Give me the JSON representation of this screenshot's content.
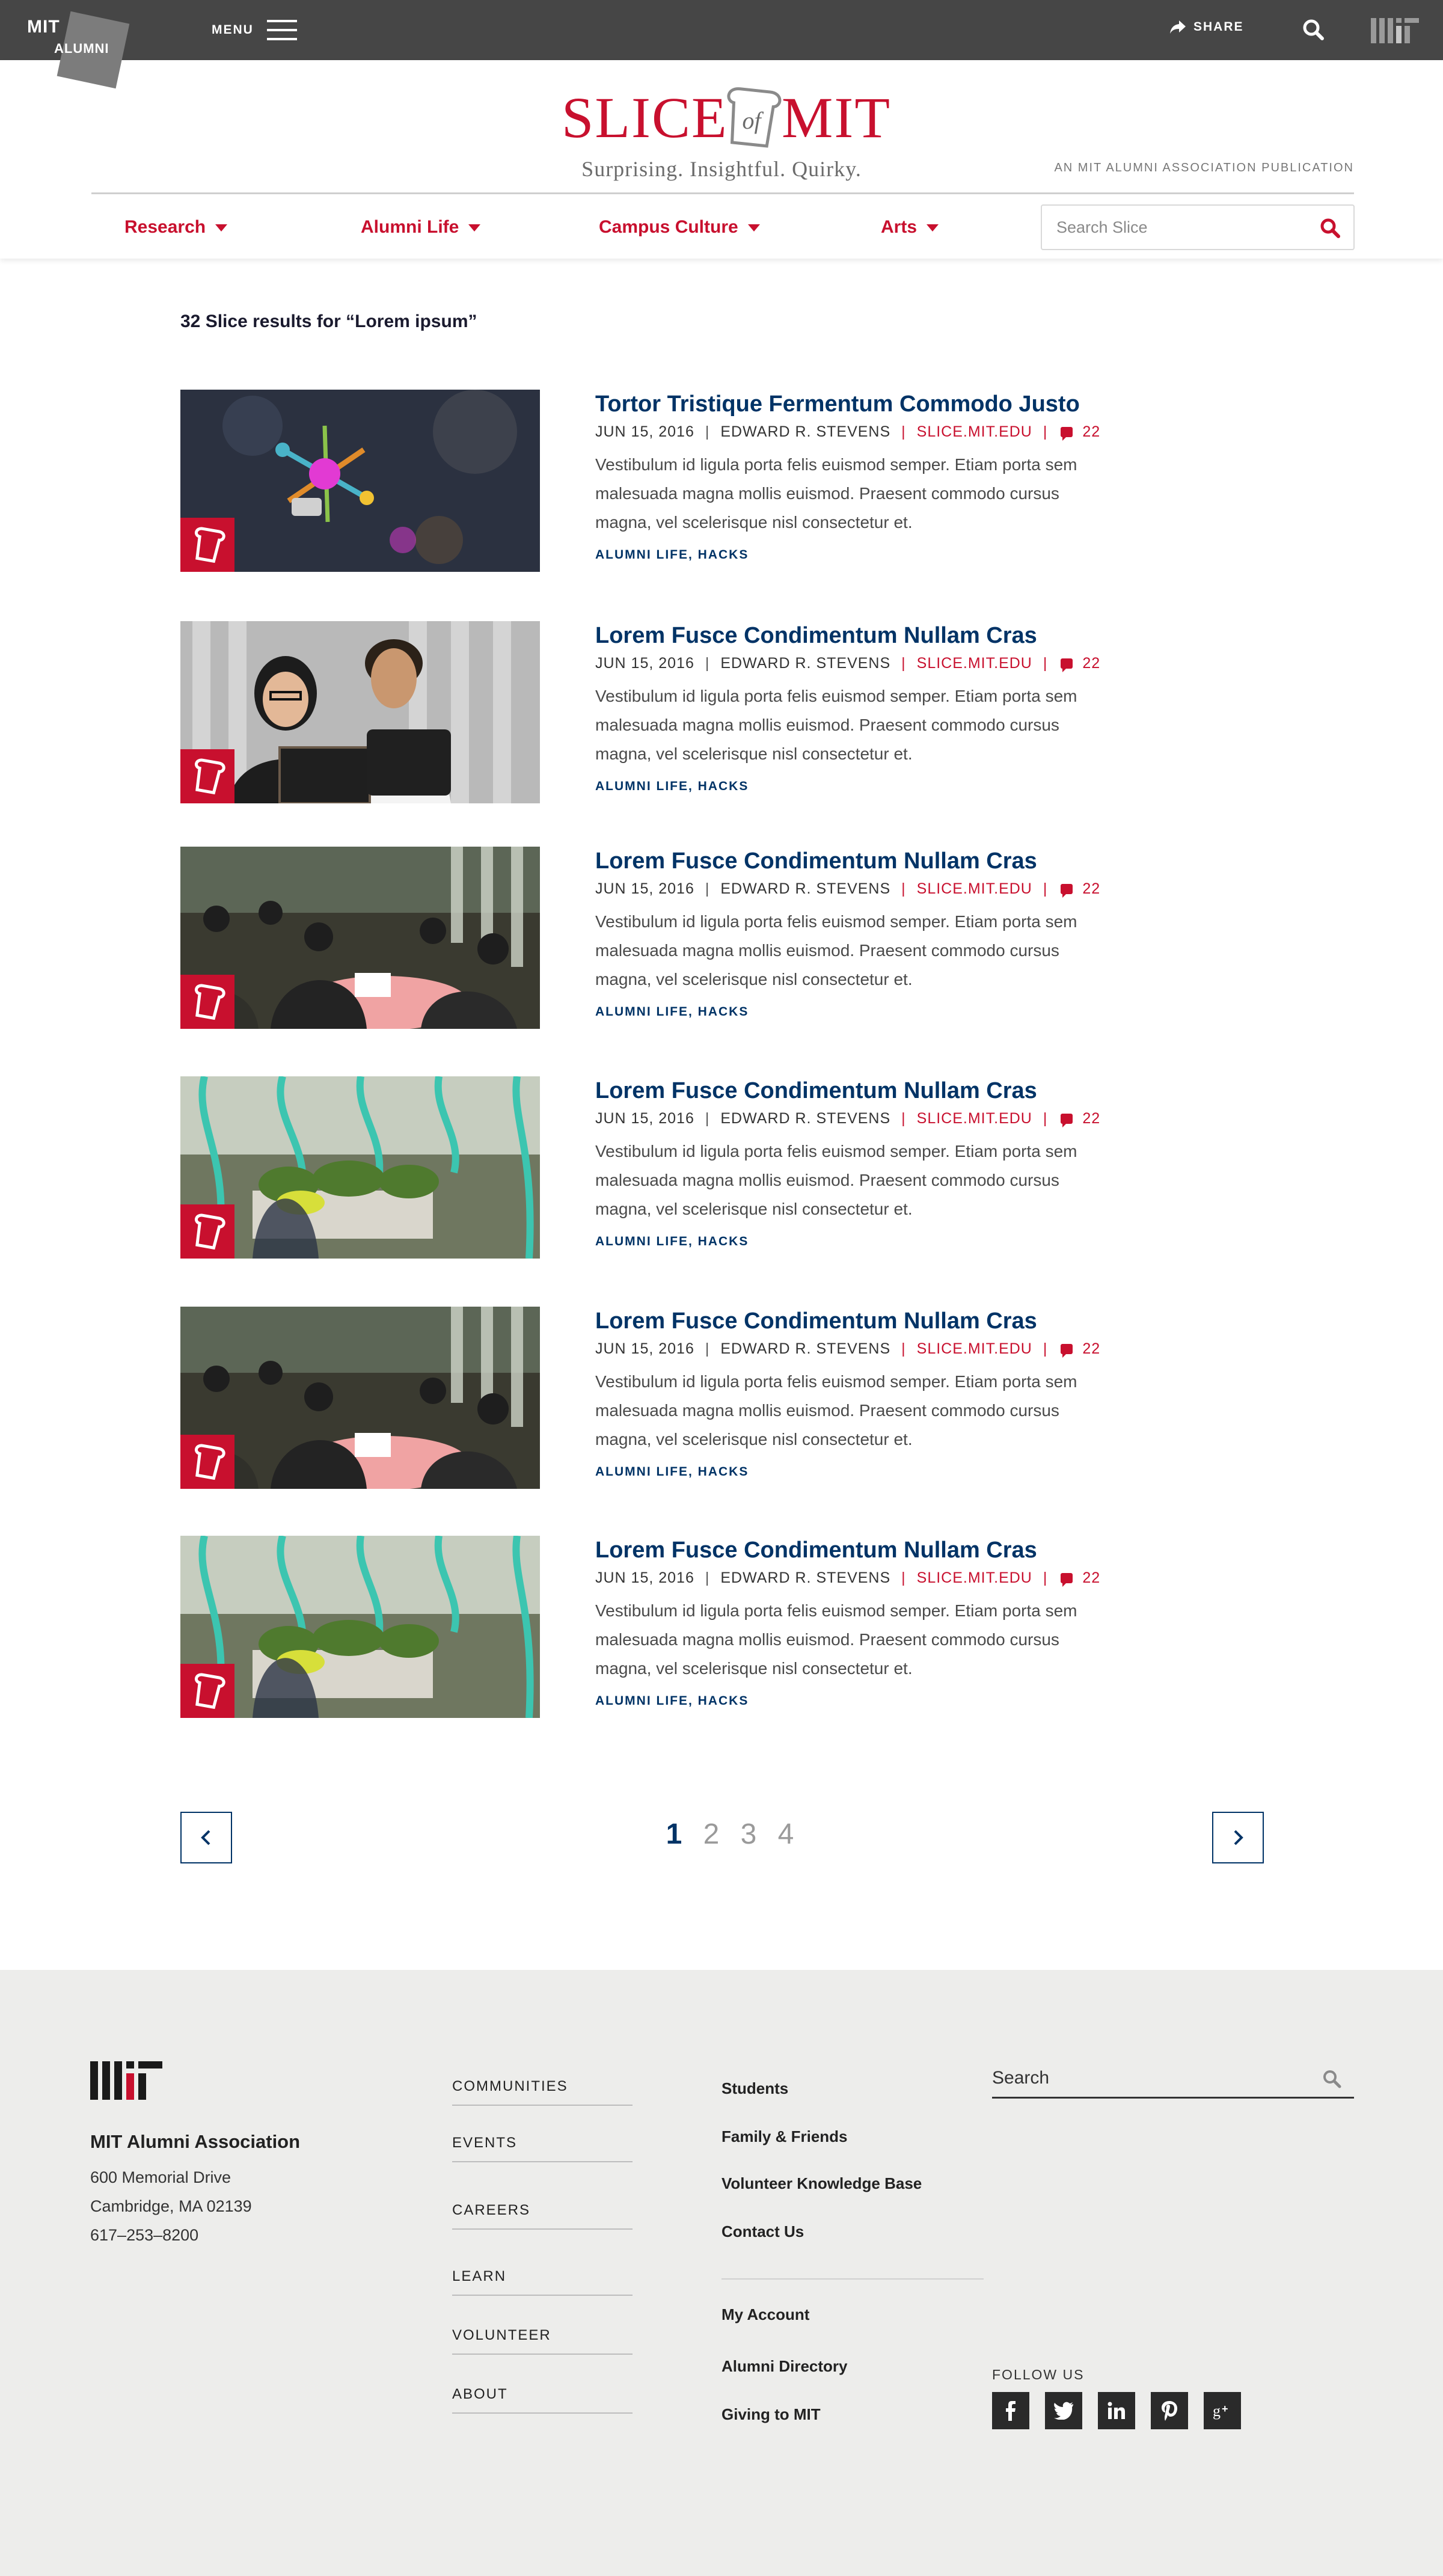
{
  "topbar": {
    "logo_mit": "MIT",
    "logo_alumni": "ALUMNI",
    "menu_label": "MENU",
    "share_label": "SHARE"
  },
  "masthead": {
    "slice_left": "SLICE",
    "slice_of": "of",
    "slice_right": "MIT",
    "tagline": "Surprising. Insightful. Quirky.",
    "publication": "AN MIT ALUMNI ASSOCIATION PUBLICATION"
  },
  "nav": {
    "items": [
      {
        "label": "Research"
      },
      {
        "label": "Alumni Life"
      },
      {
        "label": "Campus Culture"
      },
      {
        "label": "Arts"
      }
    ],
    "search_placeholder": "Search Slice"
  },
  "results": {
    "count_text": "32 Slice results for “Lorem ipsum”",
    "items": [
      {
        "title": "Tortor Tristique Fermentum Commodo Justo",
        "date": "JUN 15, 2016",
        "author": "EDWARD R. STEVENS",
        "site": "SLICE.MIT.EDU",
        "comments": "22",
        "excerpt": "Vestibulum id ligula porta felis euismod semper. Etiam porta sem malesuada magna mollis euismod. Praesent commodo cursus magna, vel scelerisque nisl consectetur et.",
        "cat1": "ALUMNI LIFE",
        "cat2": "HACKS"
      },
      {
        "title": "Lorem Fusce Condimentum Nullam Cras",
        "date": "JUN 15, 2016",
        "author": "EDWARD R. STEVENS",
        "site": "SLICE.MIT.EDU",
        "comments": "22",
        "excerpt": "Vestibulum id ligula porta felis euismod semper. Etiam porta sem malesuada magna mollis euismod. Praesent commodo cursus magna, vel scelerisque nisl consectetur et.",
        "cat1": "ALUMNI LIFE",
        "cat2": "HACKS"
      },
      {
        "title": "Lorem Fusce Condimentum Nullam Cras",
        "date": "JUN 15, 2016",
        "author": "EDWARD R. STEVENS",
        "site": "SLICE.MIT.EDU",
        "comments": "22",
        "excerpt": "Vestibulum id ligula porta felis euismod semper. Etiam porta sem malesuada magna mollis euismod. Praesent commodo cursus magna, vel scelerisque nisl consectetur et.",
        "cat1": "ALUMNI LIFE",
        "cat2": "HACKS"
      },
      {
        "title": "Lorem Fusce Condimentum Nullam Cras",
        "date": "JUN 15, 2016",
        "author": "EDWARD R. STEVENS",
        "site": "SLICE.MIT.EDU",
        "comments": "22",
        "excerpt": "Vestibulum id ligula porta felis euismod semper. Etiam porta sem malesuada magna mollis euismod. Praesent commodo cursus magna, vel scelerisque nisl consectetur et.",
        "cat1": "ALUMNI LIFE",
        "cat2": "HACKS"
      },
      {
        "title": "Lorem Fusce Condimentum Nullam Cras",
        "date": "JUN 15, 2016",
        "author": "EDWARD R. STEVENS",
        "site": "SLICE.MIT.EDU",
        "comments": "22",
        "excerpt": "Vestibulum id ligula porta felis euismod semper. Etiam porta sem malesuada magna mollis euismod. Praesent commodo cursus magna, vel scelerisque nisl consectetur et.",
        "cat1": "ALUMNI LIFE",
        "cat2": "HACKS"
      },
      {
        "title": "Lorem Fusce Condimentum Nullam Cras",
        "date": "JUN 15, 2016",
        "author": "EDWARD R. STEVENS",
        "site": "SLICE.MIT.EDU",
        "comments": "22",
        "excerpt": "Vestibulum id ligula porta felis euismod semper. Etiam porta sem malesuada magna mollis euismod. Praesent commodo cursus magna, vel scelerisque nisl consectetur et.",
        "cat1": "ALUMNI LIFE",
        "cat2": "HACKS"
      }
    ]
  },
  "pagination": {
    "pages": [
      "1",
      "2",
      "3",
      "4"
    ],
    "current": "1"
  },
  "footer": {
    "org": "MIT Alumni Association",
    "address1": "600 Memorial Drive",
    "address2": "Cambridge, MA 02139",
    "phone": "617–253–8200",
    "col1": [
      "COMMUNITIES",
      "EVENTS",
      "CAREERS",
      "LEARN",
      "VOLUNTEER",
      "ABOUT"
    ],
    "col2a": [
      "Students",
      "Family & Friends",
      "Volunteer Knowledge Base",
      "Contact Us"
    ],
    "col2b": [
      "My Account",
      "Alumni Directory",
      "Giving to MIT"
    ],
    "search_placeholder": "Search",
    "follow": "FOLLOW US",
    "socials": [
      "facebook-icon",
      "twitter-icon",
      "linkedin-icon",
      "pinterest-icon",
      "google-plus-icon"
    ]
  },
  "colors": {
    "brand_red": "#c8102e",
    "navy": "#003366",
    "topbar": "#464646",
    "footer_bg": "#ededeb"
  }
}
